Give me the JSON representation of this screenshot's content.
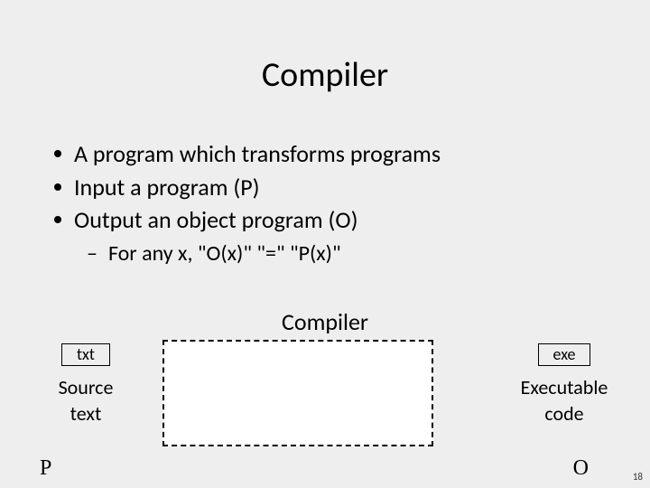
{
  "title": "Compiler",
  "bullets": {
    "b0": "A program which transforms programs",
    "b1": "Input a program (P)",
    "b2": "Output an object program (O)",
    "sub0_dash": "–",
    "sub0": "For any x, \"O(x)\" \"=\" \"P(x)\""
  },
  "diagram": {
    "compiler_label": "Compiler",
    "left_ext": "txt",
    "left_line1": "Source",
    "left_line2": "text",
    "left_var": "P",
    "right_ext": "exe",
    "right_line1": "Executable",
    "right_line2": "code",
    "right_var": "O"
  },
  "page_number": "18"
}
